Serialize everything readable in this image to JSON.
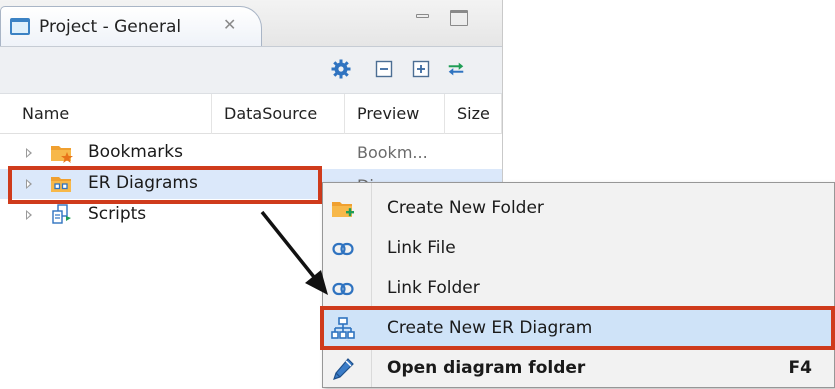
{
  "panel": {
    "tab_title": "Project - General",
    "tab_close_glyph": "✕",
    "toolbar_icons": [
      "gear-icon",
      "collapse-all-icon",
      "expand-all-icon",
      "link-with-editor-icon"
    ],
    "columns": [
      "Name",
      "DataSource",
      "Preview",
      "Size"
    ],
    "tree": [
      {
        "label": "Bookmarks",
        "icon": "bookmarks-folder-icon",
        "preview": "Bookm..."
      },
      {
        "label": "ER Diagrams",
        "icon": "er-diagrams-folder-icon",
        "preview": "Diagra..."
      },
      {
        "label": "Scripts",
        "icon": "scripts-icon",
        "preview": ""
      }
    ]
  },
  "context_menu": {
    "items": [
      {
        "label": "Create New Folder",
        "icon": "new-folder-icon",
        "shortcut": ""
      },
      {
        "label": "Link File",
        "icon": "link-icon",
        "shortcut": ""
      },
      {
        "label": "Link Folder",
        "icon": "link-icon",
        "shortcut": ""
      },
      {
        "label": "Create New ER Diagram",
        "icon": "er-diagram-icon",
        "shortcut": ""
      },
      {
        "label": "Open diagram folder",
        "icon": "pencil-icon",
        "shortcut": "F4"
      }
    ]
  },
  "colors": {
    "highlight_border": "#cf3b1c",
    "selection": "#dbe8fa",
    "menu_hover": "#cfe3f8",
    "menu_bg": "#f2f2f2"
  }
}
